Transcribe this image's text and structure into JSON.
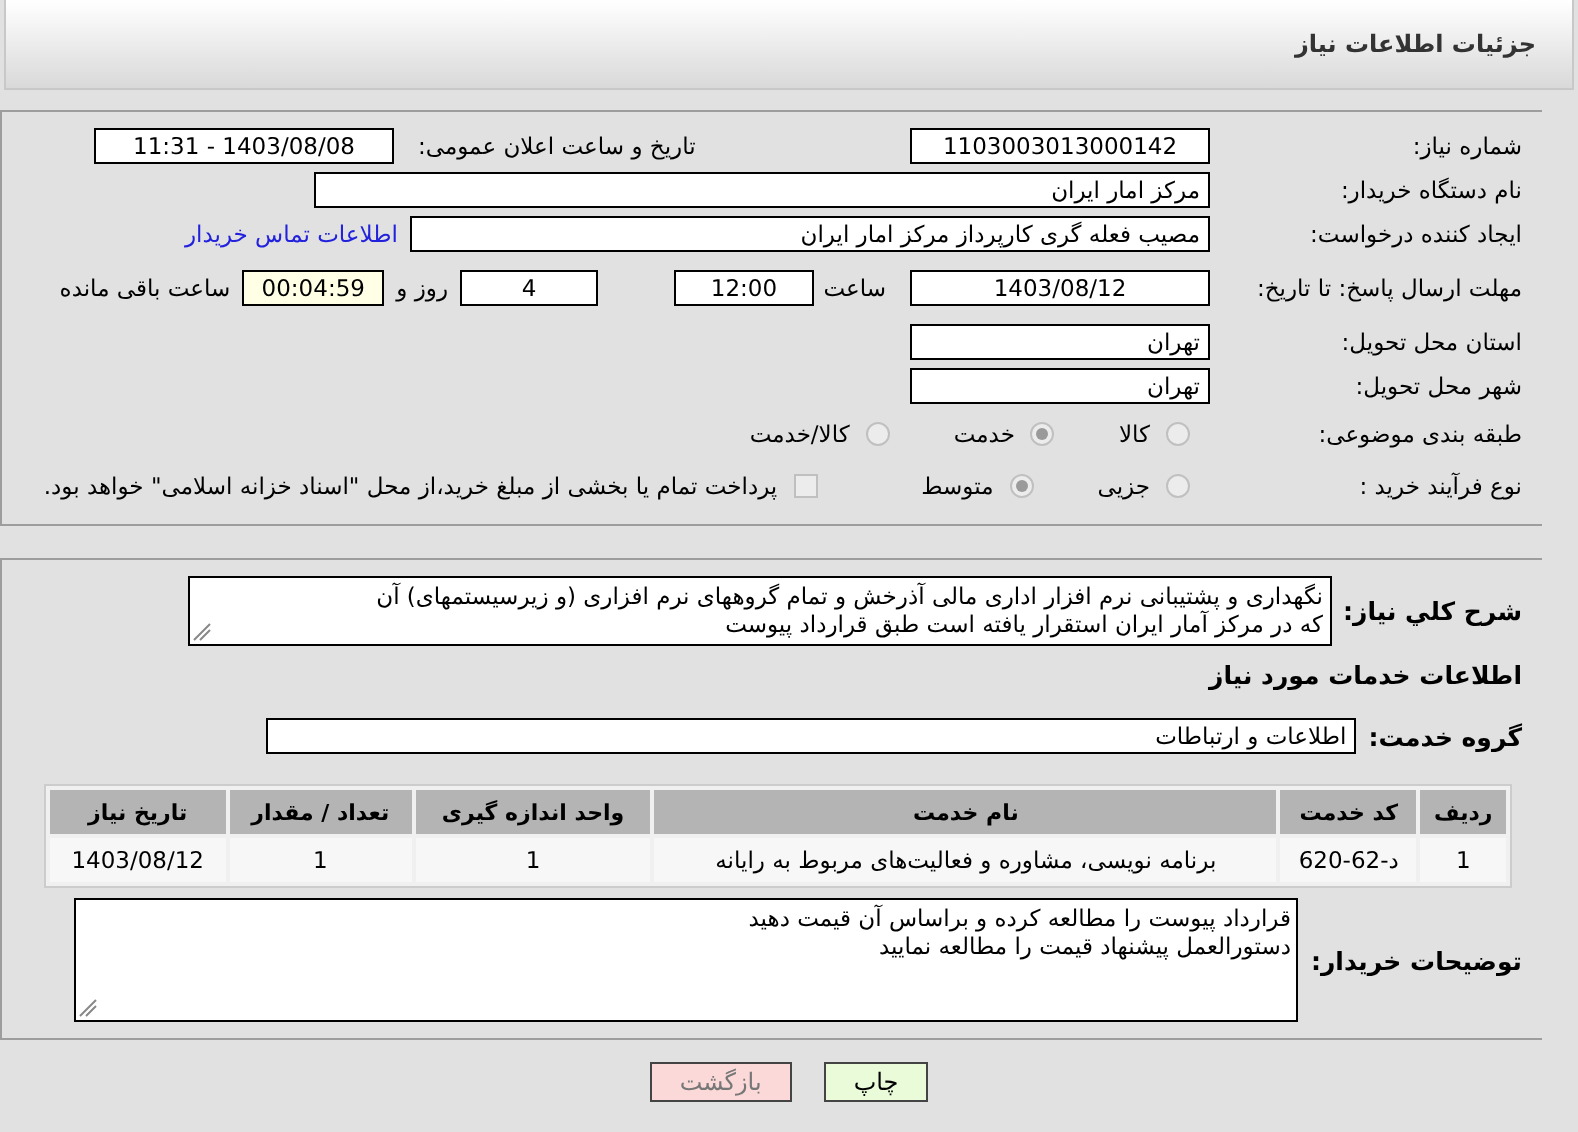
{
  "header": {
    "title": "جزئیات اطلاعات نیاز"
  },
  "details": {
    "need_number": {
      "label": "شماره نیاز:",
      "value": "1103003013000142"
    },
    "announce": {
      "label": "تاریخ و ساعت اعلان عمومی:",
      "value": "1403/08/08 - 11:31"
    },
    "buyer": {
      "label": "نام دستگاه خریدار:",
      "value": "مرکز امار ایران"
    },
    "creator": {
      "label": "ایجاد کننده درخواست:",
      "value": "مصیب فعله گری کارپرداز مرکز امار ایران",
      "link": "اطلاعات تماس خریدار"
    },
    "deadline": {
      "label": "مهلت ارسال پاسخ: تا تاریخ:",
      "date": "1403/08/12",
      "time_label": "ساعت",
      "time": "12:00",
      "days": "4",
      "days_label": "روز و",
      "remaining": "00:04:59",
      "remaining_label": "ساعت باقی مانده"
    },
    "province": {
      "label": "استان محل تحویل:",
      "value": "تهران"
    },
    "city": {
      "label": "شهر محل تحویل:",
      "value": "تهران"
    },
    "category": {
      "label": "طبقه بندی موضوعی:",
      "options": [
        {
          "label": "کالا",
          "selected": false
        },
        {
          "label": "خدمت",
          "selected": true
        },
        {
          "label": "کالا/خدمت",
          "selected": false
        }
      ]
    },
    "process": {
      "label": "نوع فرآیند خرید :",
      "options": [
        {
          "label": "جزیی",
          "selected": false
        },
        {
          "label": "متوسط",
          "selected": true
        }
      ],
      "payment": {
        "checked": false,
        "text": "پرداخت تمام یا بخشی از مبلغ خرید،از محل \"اسناد خزانه اسلامی\" خواهد بود."
      }
    }
  },
  "needs": {
    "summary": {
      "label": "شرح کلي نیاز:",
      "lines": [
        "نگهداری و پشتیبانی نرم افزار اداری مالی آذرخش و تمام گروههای نرم افزاری (و زیرسیستمهای) آن",
        "که در مرکز آمار ایران استقرار یافته است طبق قرارداد پیوست"
      ]
    },
    "services_heading": "اطلاعات خدمات مورد نیاز",
    "group": {
      "label": "گروه خدمت:",
      "value": "اطلاعات و ارتباطات"
    },
    "table": {
      "columns": [
        "ردیف",
        "کد خدمت",
        "نام خدمت",
        "واحد اندازه گیری",
        "تعداد / مقدار",
        "تاریخ نیاز"
      ],
      "rows": [
        [
          "1",
          "د-62-620",
          "برنامه نویسی، مشاوره و فعالیت‌های مربوط به رایانه",
          "1",
          "1",
          "1403/08/12"
        ]
      ]
    },
    "buyer_notes": {
      "label": "توضیحات خریدار:",
      "lines": [
        "قرارداد پیوست را مطالعه کرده و براساس آن قیمت دهید",
        "دستورالعمل پیشنهاد قیمت را مطالعه نمایید"
      ]
    }
  },
  "buttons": [
    {
      "kind": "print",
      "label": "چاپ"
    },
    {
      "kind": "back",
      "label": "بازگشت"
    }
  ]
}
